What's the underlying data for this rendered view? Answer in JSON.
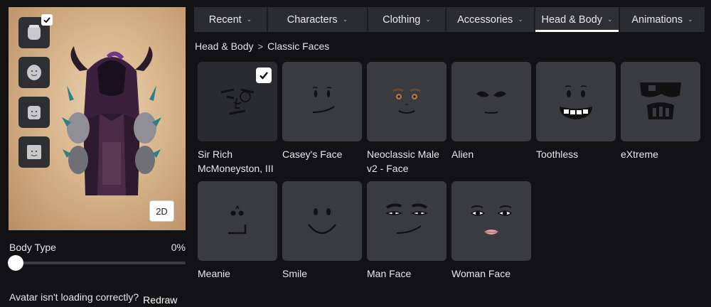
{
  "tabs": [
    {
      "label": "Recent"
    },
    {
      "label": "Characters"
    },
    {
      "label": "Clothing"
    },
    {
      "label": "Accessories"
    },
    {
      "label": "Head & Body",
      "active": true
    },
    {
      "label": "Animations"
    }
  ],
  "breadcrumb": {
    "parent": "Head & Body",
    "separator": ">",
    "current": "Classic Faces"
  },
  "preview": {
    "view_toggle_label": "2D"
  },
  "body_type": {
    "label": "Body Type",
    "value_text": "0%",
    "value": 0
  },
  "help": {
    "text": "Avatar isn't loading correctly?",
    "action_label": "Redraw"
  },
  "items": [
    {
      "name": "Sir Rich McMoneyston, III",
      "selected": true,
      "icon": "sir-rich-face"
    },
    {
      "name": "Casey's Face",
      "icon": "casey-face"
    },
    {
      "name": "Neoclassic Male v2 - Face",
      "icon": "neoclassic-male-face"
    },
    {
      "name": "Alien",
      "icon": "alien-face"
    },
    {
      "name": "Toothless",
      "icon": "toothless-face"
    },
    {
      "name": "eXtreme",
      "icon": "extreme-face"
    },
    {
      "name": "Meanie",
      "icon": "meanie-face"
    },
    {
      "name": "Smile",
      "icon": "smile-face"
    },
    {
      "name": "Man Face",
      "icon": "man-face"
    },
    {
      "name": "Woman Face",
      "icon": "woman-face"
    }
  ],
  "colors": {
    "background": "#121215",
    "tab_bar": "#2b2c31",
    "card": "#3a3b40",
    "active_underline": "#ffffff"
  }
}
